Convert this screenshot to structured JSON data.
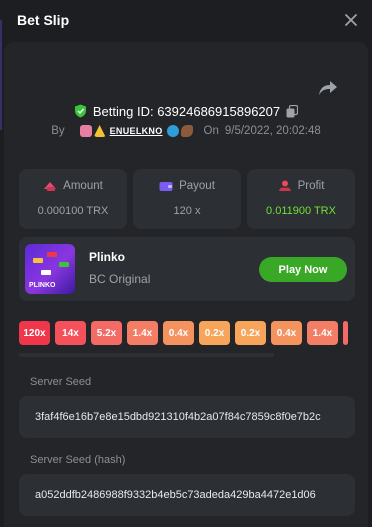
{
  "header": {
    "title": "Bet Slip"
  },
  "bet": {
    "id_label": "Betting ID: 63924686915896207",
    "by_label": "By",
    "username": "ENUELKNO",
    "on_label": "On",
    "datetime": "9/5/2022, 20:02:48"
  },
  "stats": {
    "amount_label": "Amount",
    "amount_value": "0.000100 TRX",
    "payout_label": "Payout",
    "payout_value": "120 x",
    "profit_label": "Profit",
    "profit_value": "0.011900 TRX"
  },
  "game": {
    "name": "Plinko",
    "subtitle": "BC Original",
    "thumb_text": "PLINKO",
    "play_label": "Play Now"
  },
  "multipliers": [
    "120x",
    "14x",
    "5.2x",
    "1.4x",
    "0.4x",
    "0.2x",
    "0.2x",
    "0.4x",
    "1.4x"
  ],
  "seeds": {
    "server_label": "Server Seed",
    "server_value": "3faf4f6e16b7e8e15dbd921310f4b2a07f84c7859c8f0e7b2c",
    "hash_label": "Server Seed (hash)",
    "hash_value": "a052ddfb2486988f9332b4eb5c73adeda429ba4472e1d06"
  },
  "colors": {
    "accent_green": "#3aa827",
    "profit_green": "#6fe036",
    "multiplier_colors": [
      "#f0364a",
      "#f4515b",
      "#f46a64",
      "#f47d66",
      "#f5935f",
      "#f6a55a",
      "#f6a55a",
      "#f5935f",
      "#f47d66"
    ]
  },
  "icons": [
    "close-icon",
    "share-icon",
    "shield-icon",
    "copy-icon",
    "amount-icon",
    "payout-icon",
    "profit-icon"
  ]
}
